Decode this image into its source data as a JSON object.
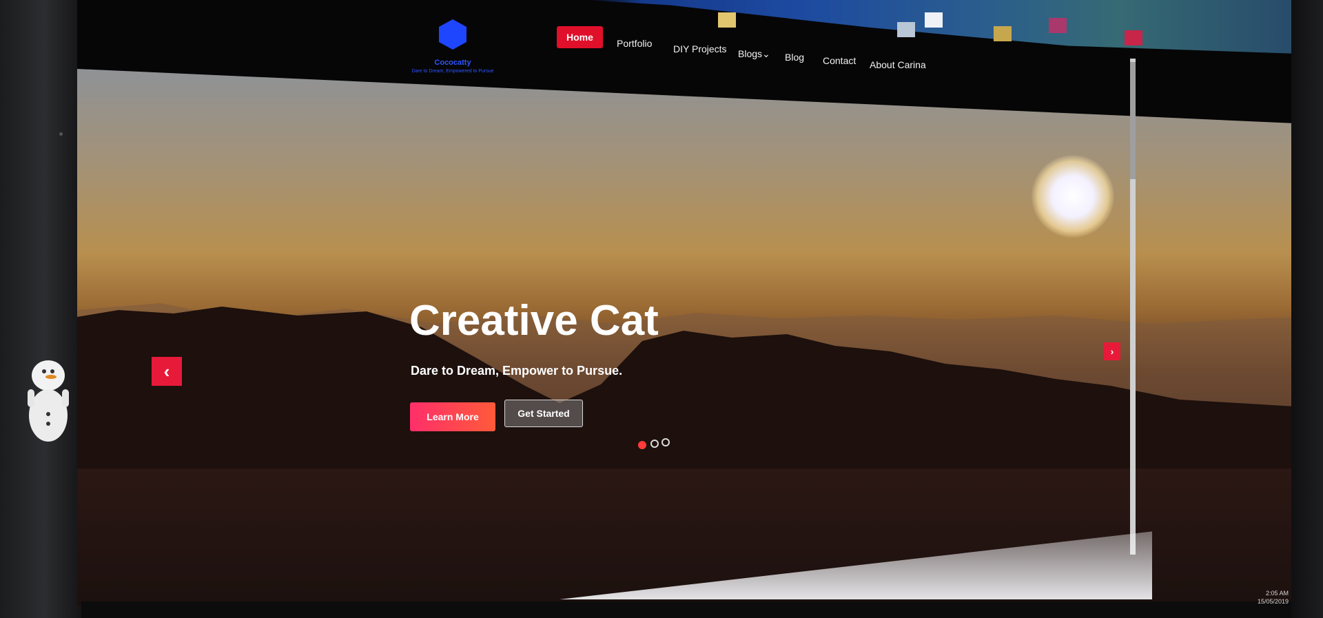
{
  "logo": {
    "name": "Cococatty",
    "tagline": "Dare to Dream, Empowered to Pursue",
    "color": "#2d55ff"
  },
  "nav": {
    "items": [
      {
        "label": "Home",
        "active": true
      },
      {
        "label": "Portfolio"
      },
      {
        "label": "DIY Projects"
      },
      {
        "label": "Blogs"
      },
      {
        "label": "Blog"
      },
      {
        "label": "Contact"
      },
      {
        "label": "About Carina"
      }
    ],
    "accent": "#e0102a"
  },
  "hero": {
    "title": "Creative Cat",
    "subtitle": "Dare to Dream, Empower to Pursue.",
    "primary_button": "Learn More",
    "secondary_button": "Get Started",
    "prev_icon": "chevron-left-icon",
    "next_icon": "chevron-right-icon",
    "slides": 3,
    "active_slide": 1
  },
  "taskbar": {
    "time": "2:05 AM",
    "date": "15/05/2019"
  }
}
